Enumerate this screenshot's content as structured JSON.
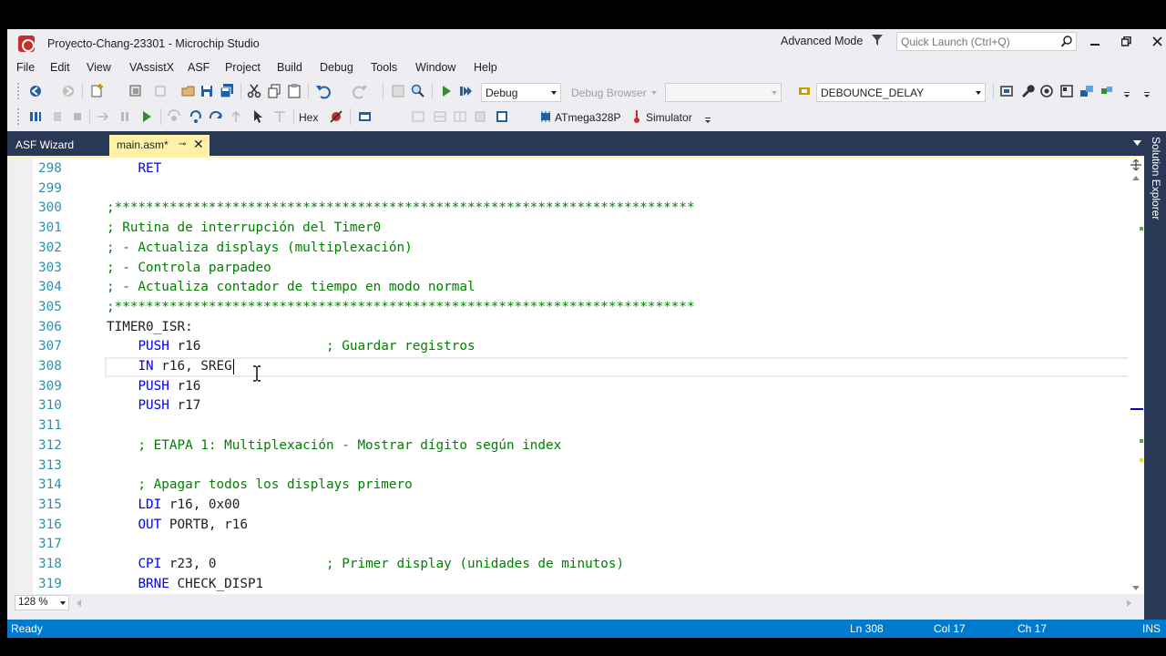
{
  "window": {
    "title": "Proyecto-Chang-23301 - Microchip Studio",
    "mode": "Advanced Mode",
    "quick_launch_placeholder": "Quick Launch (Ctrl+Q)"
  },
  "menu": [
    "File",
    "Edit",
    "View",
    "VAssistX",
    "ASF",
    "Project",
    "Build",
    "Debug",
    "Tools",
    "Window",
    "Help"
  ],
  "toolbar1": {
    "config": "Debug",
    "debug_browser": "Debug Browser",
    "platform": "",
    "symbol": "DEBOUNCE_DELAY"
  },
  "toolbar2": {
    "hex_label": "Hex",
    "device": "ATmega328P",
    "tool": "Simulator"
  },
  "tabs": {
    "asf_wizard": "ASF Wizard",
    "active_file": "main.asm*"
  },
  "right_rail": {
    "solution_explorer": "Solution Explorer"
  },
  "editor": {
    "caret_line": 308,
    "lines": [
      {
        "n": "298",
        "text": "    RET"
      },
      {
        "n": "299",
        "text": ""
      },
      {
        "n": "300",
        "text": ";**************************************************************************"
      },
      {
        "n": "301",
        "text": "; Rutina de interrupción del Timer0"
      },
      {
        "n": "302",
        "text": "; - Actualiza displays (multiplexación)"
      },
      {
        "n": "303",
        "text": "; - Controla parpadeo"
      },
      {
        "n": "304",
        "text": "; - Actualiza contador de tiempo en modo normal"
      },
      {
        "n": "305",
        "text": ";**************************************************************************"
      },
      {
        "n": "306",
        "text": "TIMER0_ISR:"
      },
      {
        "n": "307",
        "text": "    PUSH r16                ; Guardar registros"
      },
      {
        "n": "308",
        "text": "    IN r16, SREG"
      },
      {
        "n": "309",
        "text": "    PUSH r16"
      },
      {
        "n": "310",
        "text": "    PUSH r17"
      },
      {
        "n": "311",
        "text": ""
      },
      {
        "n": "312",
        "text": "    ; ETAPA 1: Multiplexación - Mostrar dígito según index"
      },
      {
        "n": "313",
        "text": ""
      },
      {
        "n": "314",
        "text": "    ; Apagar todos los displays primero"
      },
      {
        "n": "315",
        "text": "    LDI r16, 0x00"
      },
      {
        "n": "316",
        "text": "    OUT PORTB, r16"
      },
      {
        "n": "317",
        "text": ""
      },
      {
        "n": "318",
        "text": "    CPI r23, 0              ; Primer display (unidades de minutos)"
      },
      {
        "n": "319",
        "text": "    BRNE CHECK_DISP1"
      }
    ]
  },
  "zoom": "128 %",
  "status": {
    "state": "Ready",
    "line": "Ln 308",
    "col": "Col 17",
    "ch": "Ch 17",
    "mode": "INS"
  },
  "colors": {
    "accent": "#007acc",
    "tab_active": "#fff1a8",
    "tabstrip": "#293955",
    "keyword": "#0000ff",
    "comment": "#008000",
    "line_number": "#2b91af"
  }
}
